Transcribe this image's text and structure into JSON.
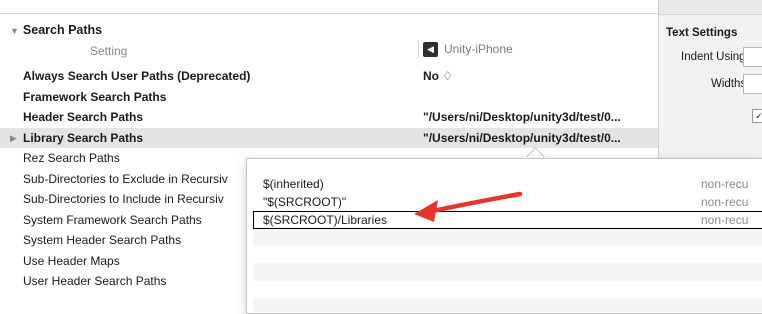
{
  "section": {
    "title": "Search Paths"
  },
  "columns": {
    "setting": "Setting",
    "target": "Unity-iPhone",
    "target_icon": "unity-logo-icon"
  },
  "rows": [
    {
      "name": "Always Search User Paths (Deprecated)",
      "value": "No ♢",
      "bold": true
    },
    {
      "name": "Framework Search Paths",
      "value": "",
      "bold": true
    },
    {
      "name": "Header Search Paths",
      "value": "\"/Users/ni/Desktop/unity3d/test/0...",
      "bold": true
    },
    {
      "name": "Library Search Paths",
      "value": "\"/Users/ni/Desktop/unity3d/test/0...",
      "bold": true,
      "selected": true
    },
    {
      "name": "Rez Search Paths",
      "value": ""
    },
    {
      "name": "Sub-Directories to Exclude in Recursiv",
      "value": ""
    },
    {
      "name": "Sub-Directories to Include in Recursiv",
      "value": ""
    },
    {
      "name": "System Framework Search Paths",
      "value": ""
    },
    {
      "name": "System Header Search Paths",
      "value": ""
    },
    {
      "name": "Use Header Maps",
      "value": ""
    },
    {
      "name": "User Header Search Paths",
      "value": ""
    }
  ],
  "popover": {
    "items": [
      {
        "value": "$(inherited)",
        "mode": "non-recu"
      },
      {
        "value": "\"$(SRCROOT)\"",
        "mode": "non-recu"
      },
      {
        "value": "$(SRCROOT)/Libraries",
        "mode": "non-recu",
        "editing": true
      }
    ]
  },
  "inspector": {
    "title": "Text Settings",
    "indent_label": "Indent Using",
    "widths_label": "Widths",
    "check_mark": "✓"
  },
  "annotation": {
    "color": "#e8352b"
  }
}
